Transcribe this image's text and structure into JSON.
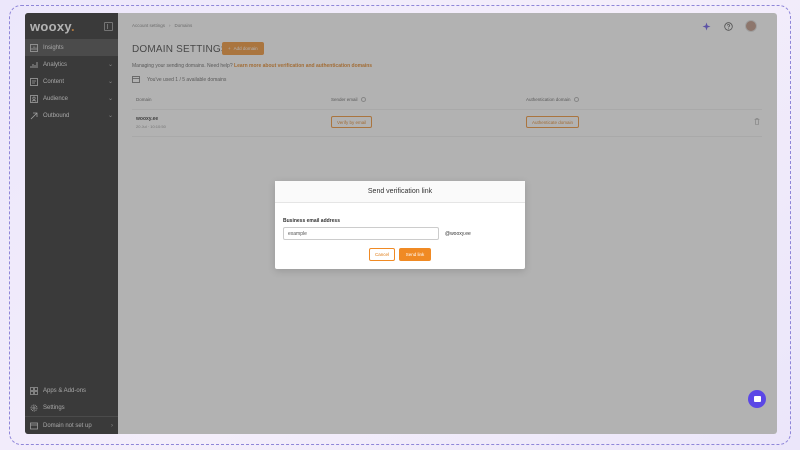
{
  "app": {
    "logo_text": "wooxy",
    "logo_accent": "."
  },
  "sidebar": {
    "items": [
      {
        "label": "Insights",
        "icon": "insights-icon",
        "active": true,
        "chevron": ""
      },
      {
        "label": "Analytics",
        "icon": "analytics-icon",
        "chevron": "⌄"
      },
      {
        "label": "Content",
        "icon": "content-icon",
        "chevron": "⌄"
      },
      {
        "label": "Audience",
        "icon": "audience-icon",
        "chevron": "⌄"
      },
      {
        "label": "Outbound",
        "icon": "outbound-icon",
        "chevron": "⌄"
      }
    ],
    "bottom_items": [
      {
        "label": "Apps & Add-ons",
        "icon": "apps-icon",
        "chevron": ""
      },
      {
        "label": "Settings",
        "icon": "gear-icon",
        "chevron": ""
      },
      {
        "label": "Domain not set up",
        "icon": "domain-icon",
        "chevron": "›"
      }
    ]
  },
  "header": {
    "breadcrumb": [
      "Account settings",
      "Domains"
    ],
    "icons": [
      "sparkle-icon",
      "help-icon"
    ]
  },
  "page": {
    "title": "DOMAIN SETTINGS",
    "add_domain_label": "Add domain",
    "subtext_prefix": "Managing your sending domains. Need help?",
    "subtext_link": "Learn more about verification and authentication domains",
    "usage_text": "You've used 1 / 5 available domains"
  },
  "table": {
    "headers": {
      "domain": "Domain",
      "sender_email": "Sender email",
      "auth_domain": "Authentication domain"
    },
    "rows": [
      {
        "domain": "wooxy.ee",
        "date": "20 Jul · 10:10:50",
        "sender_button": "Verify by email",
        "auth_button": "Authenticate domain"
      }
    ]
  },
  "modal": {
    "title": "Send verification link",
    "label": "Business email address",
    "input_value": "example",
    "suffix": "@wooxy.ee",
    "cancel": "Cancel",
    "send": "Send link"
  },
  "colors": {
    "accent": "#f08a24",
    "sidebar": "#1a1a1a",
    "chat": "#5b47e6"
  }
}
